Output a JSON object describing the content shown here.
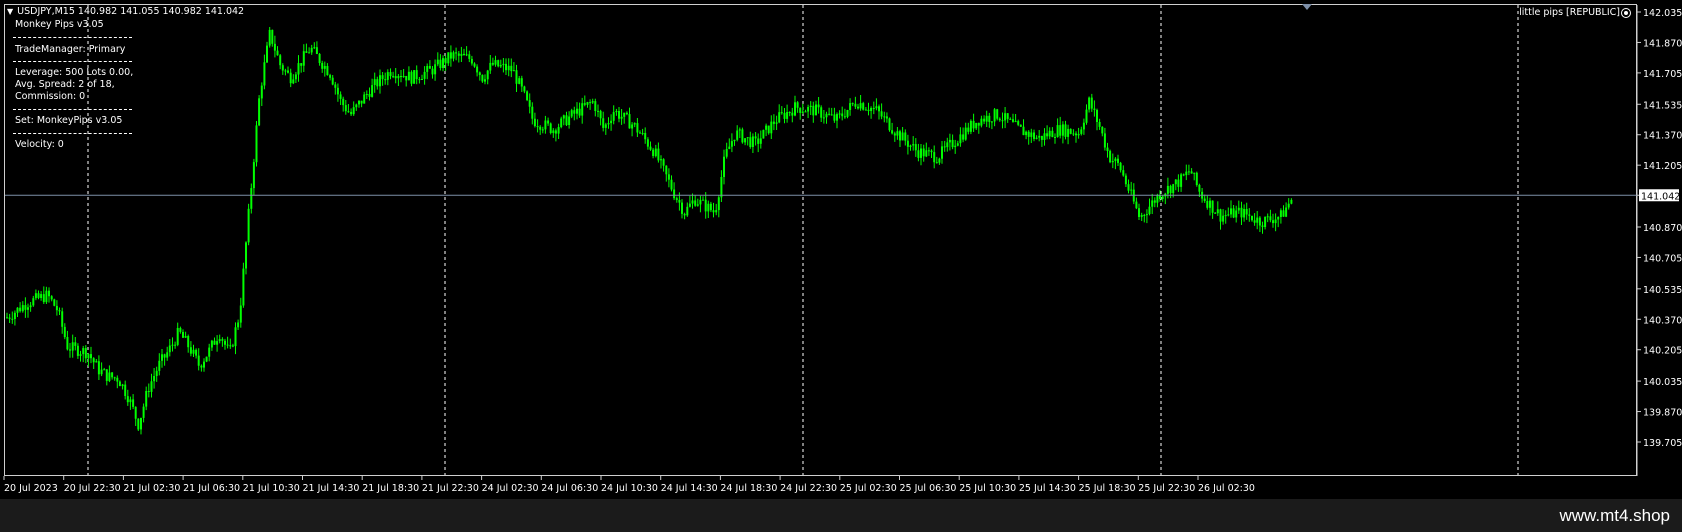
{
  "chart": {
    "header": "USDJPY,M15  140.982 141.055 140.982 141.042",
    "indicator_label": "little pips [REPUBLIC]",
    "indicator_icon": "smiley-icon",
    "current_price_label": "141.042",
    "colors": {
      "background": "#000000",
      "candles": "#00ff00",
      "grid": "#ffffff",
      "price_line": "#7d8fa8",
      "axis_text": "#ffffff"
    }
  },
  "info_panel": {
    "title": "Monkey Pips v3.05",
    "trade_manager": "TradeManager: Primary",
    "leverage": "Leverage: 500 Lots 0.00,",
    "avg_spread": "Avg. Spread: 2 of 18,",
    "commission": "Commission: 0",
    "set": "Set: MonkeyPips v3.05",
    "velocity": "Velocity: 0"
  },
  "footer": {
    "brand": "www.mt4.shop"
  },
  "chart_data": {
    "type": "candlestick",
    "symbol": "USDJPY",
    "timeframe": "M15",
    "y_ticks": [
      "142.035",
      "141.870",
      "141.705",
      "141.535",
      "141.370",
      "141.205",
      "141.042",
      "140.870",
      "140.705",
      "140.535",
      "140.370",
      "140.205",
      "140.035",
      "139.870",
      "139.705"
    ],
    "ylim": [
      139.705,
      142.035
    ],
    "current_price": 141.042,
    "x_ticks": [
      "20 Jul 2023",
      "20 Jul 22:30",
      "21 Jul 02:30",
      "21 Jul 06:30",
      "21 Jul 10:30",
      "21 Jul 14:30",
      "21 Jul 18:30",
      "21 Jul 22:30",
      "24 Jul 02:30",
      "24 Jul 06:30",
      "24 Jul 10:30",
      "24 Jul 14:30",
      "24 Jul 18:30",
      "24 Jul 22:30",
      "25 Jul 02:30",
      "25 Jul 06:30",
      "25 Jul 10:30",
      "25 Jul 14:30",
      "25 Jul 18:30",
      "25 Jul 22:30",
      "26 Jul 02:30"
    ],
    "grid": "vertical-day-separators",
    "price_path": [
      [
        0,
        140.38
      ],
      [
        2,
        140.46
      ],
      [
        4,
        140.5
      ],
      [
        5,
        140.42
      ],
      [
        6,
        140.22
      ],
      [
        8,
        140.19
      ],
      [
        9,
        140.1
      ],
      [
        10,
        140.06
      ],
      [
        11,
        140.05
      ],
      [
        12,
        139.95
      ],
      [
        13,
        139.8
      ],
      [
        14,
        140.0
      ],
      [
        15,
        140.12
      ],
      [
        16,
        140.2
      ],
      [
        17,
        140.3
      ],
      [
        18,
        140.22
      ],
      [
        19,
        140.12
      ],
      [
        20,
        140.2
      ],
      [
        21,
        140.3
      ],
      [
        22,
        140.18
      ],
      [
        23,
        140.4
      ],
      [
        24,
        141.0
      ],
      [
        25,
        141.6
      ],
      [
        26,
        141.92
      ],
      [
        27,
        141.75
      ],
      [
        28,
        141.68
      ],
      [
        30,
        141.84
      ],
      [
        32,
        141.7
      ],
      [
        33,
        141.55
      ],
      [
        34,
        141.48
      ],
      [
        36,
        141.62
      ],
      [
        38,
        141.72
      ],
      [
        40,
        141.68
      ],
      [
        42,
        141.72
      ],
      [
        44,
        141.8
      ],
      [
        46,
        141.78
      ],
      [
        47,
        141.68
      ],
      [
        48,
        141.75
      ],
      [
        50,
        141.72
      ],
      [
        51,
        141.6
      ],
      [
        52,
        141.45
      ],
      [
        54,
        141.4
      ],
      [
        56,
        141.48
      ],
      [
        58,
        141.55
      ],
      [
        59,
        141.4
      ],
      [
        60,
        141.5
      ],
      [
        62,
        141.42
      ],
      [
        64,
        141.28
      ],
      [
        66,
        141.05
      ],
      [
        67,
        140.95
      ],
      [
        68,
        141.02
      ],
      [
        70,
        140.95
      ],
      [
        71,
        141.25
      ],
      [
        72,
        141.38
      ],
      [
        74,
        141.32
      ],
      [
        76,
        141.45
      ],
      [
        78,
        141.52
      ],
      [
        80,
        141.5
      ],
      [
        82,
        141.45
      ],
      [
        84,
        141.55
      ],
      [
        86,
        141.5
      ],
      [
        88,
        141.38
      ],
      [
        90,
        141.28
      ],
      [
        92,
        141.25
      ],
      [
        94,
        141.35
      ],
      [
        96,
        141.45
      ],
      [
        98,
        141.48
      ],
      [
        100,
        141.4
      ],
      [
        102,
        141.35
      ],
      [
        104,
        141.4
      ],
      [
        106,
        141.38
      ],
      [
        107,
        141.55
      ],
      [
        108,
        141.42
      ],
      [
        109,
        141.25
      ],
      [
        110,
        141.2
      ],
      [
        112,
        140.92
      ],
      [
        114,
        141.05
      ],
      [
        116,
        141.12
      ],
      [
        117,
        141.18
      ],
      [
        118,
        141.05
      ],
      [
        120,
        140.93
      ],
      [
        122,
        140.95
      ],
      [
        124,
        140.9
      ],
      [
        126,
        140.93
      ],
      [
        127,
        141.02
      ]
    ]
  }
}
